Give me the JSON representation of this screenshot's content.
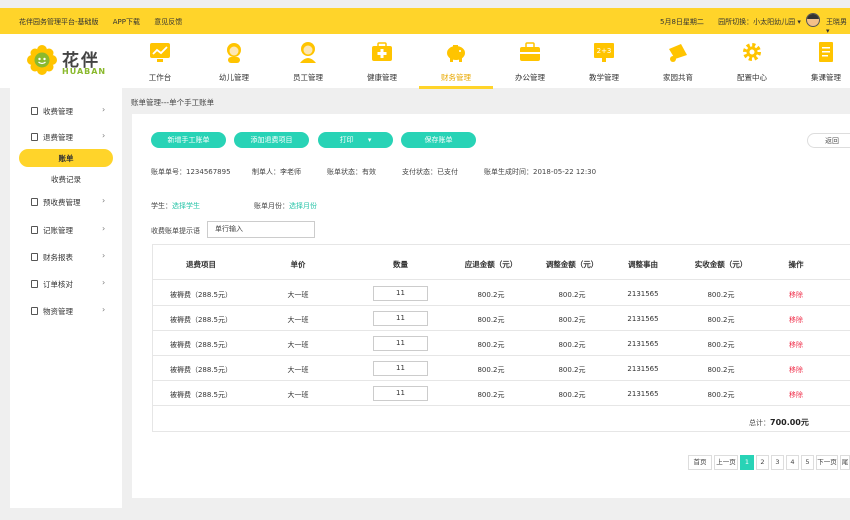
{
  "topbar": {
    "platform": "花伴园务管理平台-基础版",
    "app_download": "APP下载",
    "feedback": "意见反馈",
    "date": "5月8日星期二",
    "kindergarten_switch": "园所切换：小太阳幼儿园 ▾",
    "username": "王晓男 ▾"
  },
  "logo": {
    "cn": "花伴",
    "en": "HUABAN"
  },
  "nav": [
    {
      "label": "工作台",
      "icon": "dashboard-icon"
    },
    {
      "label": "幼儿管理",
      "icon": "child-icon"
    },
    {
      "label": "员工管理",
      "icon": "staff-icon"
    },
    {
      "label": "健康管理",
      "icon": "medical-kit-icon"
    },
    {
      "label": "财务管理",
      "icon": "piggy-bank-icon",
      "active": true
    },
    {
      "label": "办公管理",
      "icon": "briefcase-icon"
    },
    {
      "label": "教学管理",
      "icon": "math-board-icon"
    },
    {
      "label": "家园共育",
      "icon": "megaphone-icon"
    },
    {
      "label": "配置中心",
      "icon": "gear-icon"
    },
    {
      "label": "集课管理",
      "icon": "document-icon"
    }
  ],
  "sidebar": [
    {
      "label": "收费管理",
      "arrow": "›"
    },
    {
      "label": "退费管理",
      "arrow": "›"
    },
    {
      "label": "账单"
    },
    {
      "label": "收费记录"
    },
    {
      "label": "预收费管理",
      "arrow": "›"
    },
    {
      "label": "记账管理",
      "arrow": "›"
    },
    {
      "label": "财务报表",
      "arrow": "›"
    },
    {
      "label": "订单核对",
      "arrow": "›"
    },
    {
      "label": "物资管理",
      "arrow": "›"
    }
  ],
  "breadcrumb": "账单管理---单个手工账单",
  "buttons": {
    "new_bill": "新增手工账单",
    "add_refund": "添加退费项目",
    "print": "打印",
    "print_arrow": "▾",
    "save": "保存账单",
    "back": "返回"
  },
  "bill_info": {
    "bill_no": "账单单号：1234567895",
    "creator": "制单人：李老师",
    "status": "账单状态：有效",
    "pay_status": "支付状态：已支付",
    "created_time": "账单生成时间：2018-05-22  12:30"
  },
  "student_label": "学生：",
  "student_link": "选择学生",
  "month_label": "账单月份：",
  "month_link": "选择月份",
  "tip_label": "收费账单提示语",
  "tip_value": "单行输入",
  "table": {
    "headers": [
      "退费项目",
      "单价",
      "数量",
      "应退金额（元）",
      "调整金额（元）",
      "调整事由",
      "实收金额（元）",
      "操作"
    ],
    "rows": [
      {
        "item": "被褥费（288.5元）",
        "price": "大一班",
        "qty": "11",
        "due": "800.2元",
        "adjust": "800.2元",
        "reason": "2131565",
        "actual": "800.2元",
        "op": "移除"
      },
      {
        "item": "被褥费（288.5元）",
        "price": "大一班",
        "qty": "11",
        "due": "800.2元",
        "adjust": "800.2元",
        "reason": "2131565",
        "actual": "800.2元",
        "op": "移除"
      },
      {
        "item": "被褥费（288.5元）",
        "price": "大一班",
        "qty": "11",
        "due": "800.2元",
        "adjust": "800.2元",
        "reason": "2131565",
        "actual": "800.2元",
        "op": "移除"
      },
      {
        "item": "被褥费（288.5元）",
        "price": "大一班",
        "qty": "11",
        "due": "800.2元",
        "adjust": "800.2元",
        "reason": "2131565",
        "actual": "800.2元",
        "op": "移除"
      },
      {
        "item": "被褥费（288.5元）",
        "price": "大一班",
        "qty": "11",
        "due": "800.2元",
        "adjust": "800.2元",
        "reason": "2131565",
        "actual": "800.2元",
        "op": "移除"
      }
    ],
    "total_label": "总计：",
    "total_value": "700.00元"
  },
  "pagination": {
    "first": "首页",
    "prev": "上一页",
    "pages": [
      "1",
      "2",
      "3",
      "4",
      "5"
    ],
    "current": "1",
    "next": "下一页",
    "last": "尾"
  },
  "colors": {
    "accent_yellow": "#ffd42a",
    "teal": "#28d3b6",
    "link_green": "#28c4a8",
    "danger": "#f0314c"
  }
}
